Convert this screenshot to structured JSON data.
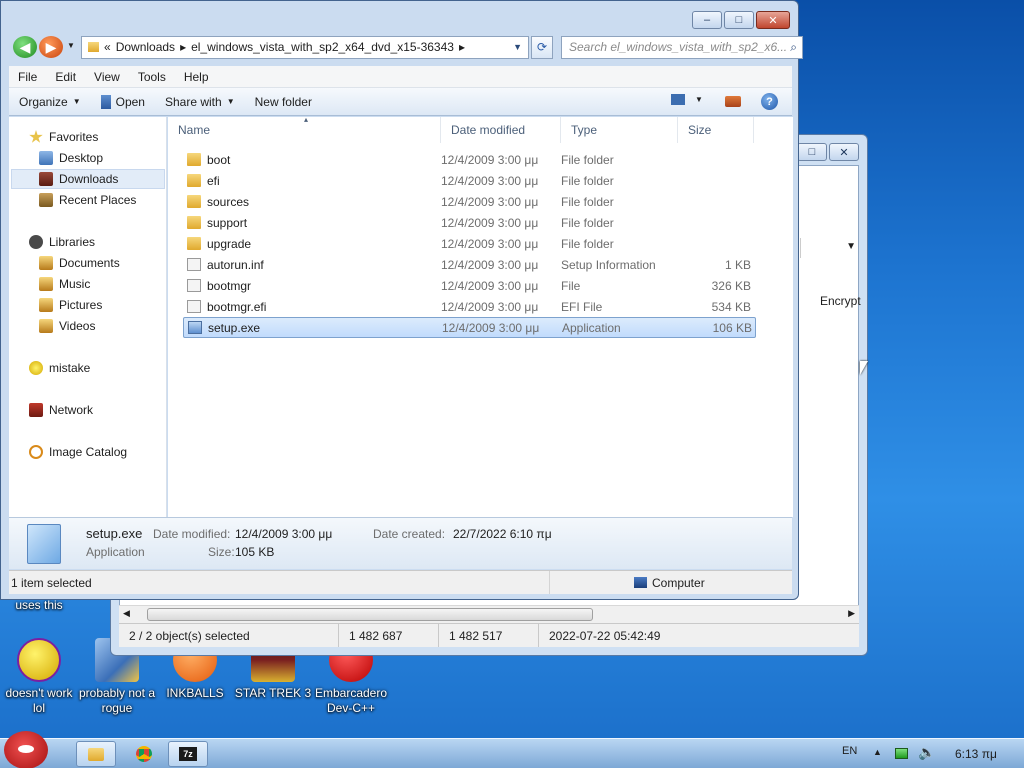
{
  "desktop": {
    "icons": [
      {
        "label": "uses this"
      },
      {
        "label": "doesn't work lol"
      },
      {
        "label": "probably not a rogue"
      },
      {
        "label": "INKBALLS"
      },
      {
        "label": "STAR TREK 3"
      },
      {
        "label": "Embarcadero Dev-C++"
      }
    ]
  },
  "back_window": {
    "column_header": "Encrypt",
    "status": {
      "selected": "2 / 2 object(s) selected",
      "size1": "1 482 687",
      "size2": "1 482 517",
      "date": "2022-07-22 05:42:49"
    }
  },
  "window": {
    "buttons": {
      "minimize": "–",
      "maximize": "□",
      "close": "✕"
    },
    "address": {
      "chevron": "«",
      "segments": [
        "Downloads",
        "el_windows_vista_with_sp2_x64_dvd_x15-36343"
      ]
    },
    "search_placeholder": "Search el_windows_vista_with_sp2_x6...",
    "menu": [
      "File",
      "Edit",
      "View",
      "Tools",
      "Help"
    ],
    "toolbar": {
      "organize": "Organize",
      "open": "Open",
      "share_with": "Share with",
      "new_folder": "New folder"
    },
    "nav": {
      "favorites": "Favorites",
      "desktop": "Desktop",
      "downloads": "Downloads",
      "recent": "Recent Places",
      "libraries": "Libraries",
      "documents": "Documents",
      "music": "Music",
      "pictures": "Pictures",
      "videos": "Videos",
      "mistake": "mistake",
      "network": "Network",
      "image_catalog": "Image Catalog"
    },
    "columns": {
      "name": "Name",
      "date": "Date modified",
      "type": "Type",
      "size": "Size"
    },
    "files": [
      {
        "name": "boot",
        "date": "12/4/2009 3:00 μμ",
        "type": "File folder",
        "size": "",
        "kind": "folder"
      },
      {
        "name": "efi",
        "date": "12/4/2009 3:00 μμ",
        "type": "File folder",
        "size": "",
        "kind": "folder"
      },
      {
        "name": "sources",
        "date": "12/4/2009 3:00 μμ",
        "type": "File folder",
        "size": "",
        "kind": "folder"
      },
      {
        "name": "support",
        "date": "12/4/2009 3:00 μμ",
        "type": "File folder",
        "size": "",
        "kind": "folder"
      },
      {
        "name": "upgrade",
        "date": "12/4/2009 3:00 μμ",
        "type": "File folder",
        "size": "",
        "kind": "folder"
      },
      {
        "name": "autorun.inf",
        "date": "12/4/2009 3:00 μμ",
        "type": "Setup Information",
        "size": "1 KB",
        "kind": "file"
      },
      {
        "name": "bootmgr",
        "date": "12/4/2009 3:00 μμ",
        "type": "File",
        "size": "326 KB",
        "kind": "file"
      },
      {
        "name": "bootmgr.efi",
        "date": "12/4/2009 3:00 μμ",
        "type": "EFI File",
        "size": "534 KB",
        "kind": "file"
      },
      {
        "name": "setup.exe",
        "date": "12/4/2009 3:00 μμ",
        "type": "Application",
        "size": "106 KB",
        "kind": "exe"
      }
    ],
    "details": {
      "filename": "setup.exe",
      "filetype": "Application",
      "date_modified_label": "Date modified:",
      "date_modified": "12/4/2009 3:00 μμ",
      "date_created_label": "Date created:",
      "date_created": "22/7/2022 6:10 πμ",
      "size_label": "Size:",
      "size": "105 KB"
    },
    "status": {
      "selected": "1 item selected",
      "location": "Computer"
    }
  },
  "taskbar": {
    "lang": "EN",
    "time": "6:13 πμ"
  }
}
